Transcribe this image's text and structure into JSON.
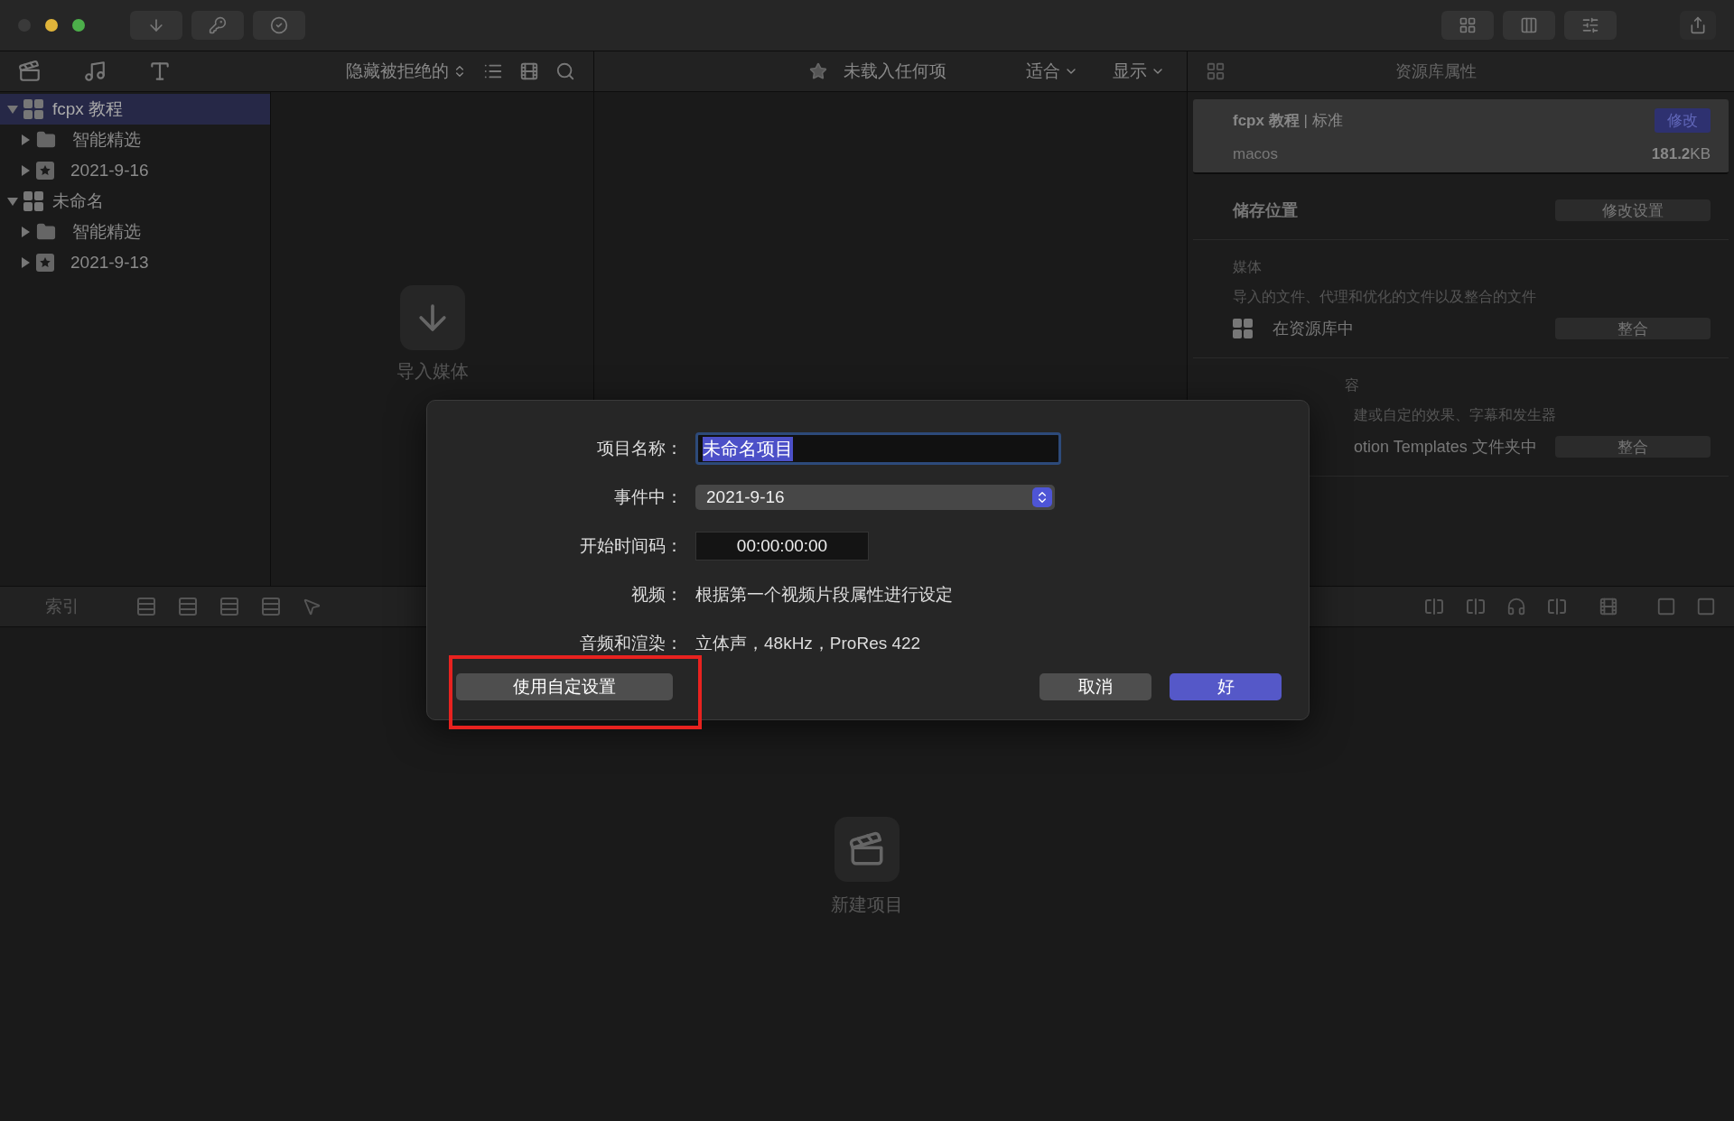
{
  "toolbar": {
    "filter_label": "隐藏被拒绝的",
    "viewer_title": "未载入任何项",
    "viewer_menus": [
      "适合",
      "显示"
    ],
    "inspector_title": "资源库属性"
  },
  "sidebar": {
    "items": [
      {
        "label": "fcpx 教程",
        "kind": "library",
        "selected": true,
        "expanded": true,
        "children": [
          {
            "label": "智能精选",
            "kind": "folder",
            "selected": false,
            "expanded": false
          },
          {
            "label": "2021-9-16",
            "kind": "event",
            "selected": false,
            "expanded": false
          }
        ]
      },
      {
        "label": "未命名",
        "kind": "library",
        "selected": false,
        "expanded": true,
        "children": [
          {
            "label": "智能精选",
            "kind": "folder",
            "selected": false,
            "expanded": false
          },
          {
            "label": "2021-9-13",
            "kind": "event",
            "selected": false,
            "expanded": false
          }
        ]
      }
    ]
  },
  "browser": {
    "empty_label": "导入媒体"
  },
  "inspector": {
    "library_name": "**fcpx 教程** | 标准",
    "library_action": "修改",
    "location": "macos",
    "size": "**181.2**KB",
    "storage": {
      "title": "储存位置",
      "button": "修改设置"
    },
    "sections": [
      {
        "kind": "full",
        "heading": "媒体",
        "description": "导入的文件、代理和优化的文件以及整合的文件",
        "location": "在资源库中",
        "button": "整合"
      },
      {
        "kind": "covered",
        "heading": "容",
        "description": "建或自定的效果、字幕和发生器",
        "location": "otion Templates 文件夹中",
        "button": "整合"
      }
    ]
  },
  "timeline_toolbar": {
    "index_label": "索引"
  },
  "timeline": {
    "empty_label": "新建项目"
  },
  "dialog": {
    "fields": [
      {
        "kind": "text",
        "label": "项目名称：",
        "value": "未命名项目",
        "selected": true
      },
      {
        "kind": "popup",
        "label": "事件中：",
        "value": "2021-9-16"
      },
      {
        "kind": "timecode",
        "label": "开始时间码：",
        "value": "00:00:00:00"
      },
      {
        "kind": "info",
        "label": "视频：",
        "value": "根据第一个视频片段属性进行设定"
      },
      {
        "kind": "info",
        "label": "音频和渲染：",
        "value": "立体声，48kHz，ProRes 422"
      }
    ],
    "buttons": [
      {
        "kind": "custom",
        "label": "使用自定设置"
      },
      {
        "kind": "cancel",
        "label": "取消"
      },
      {
        "kind": "default",
        "label": "好"
      }
    ]
  }
}
